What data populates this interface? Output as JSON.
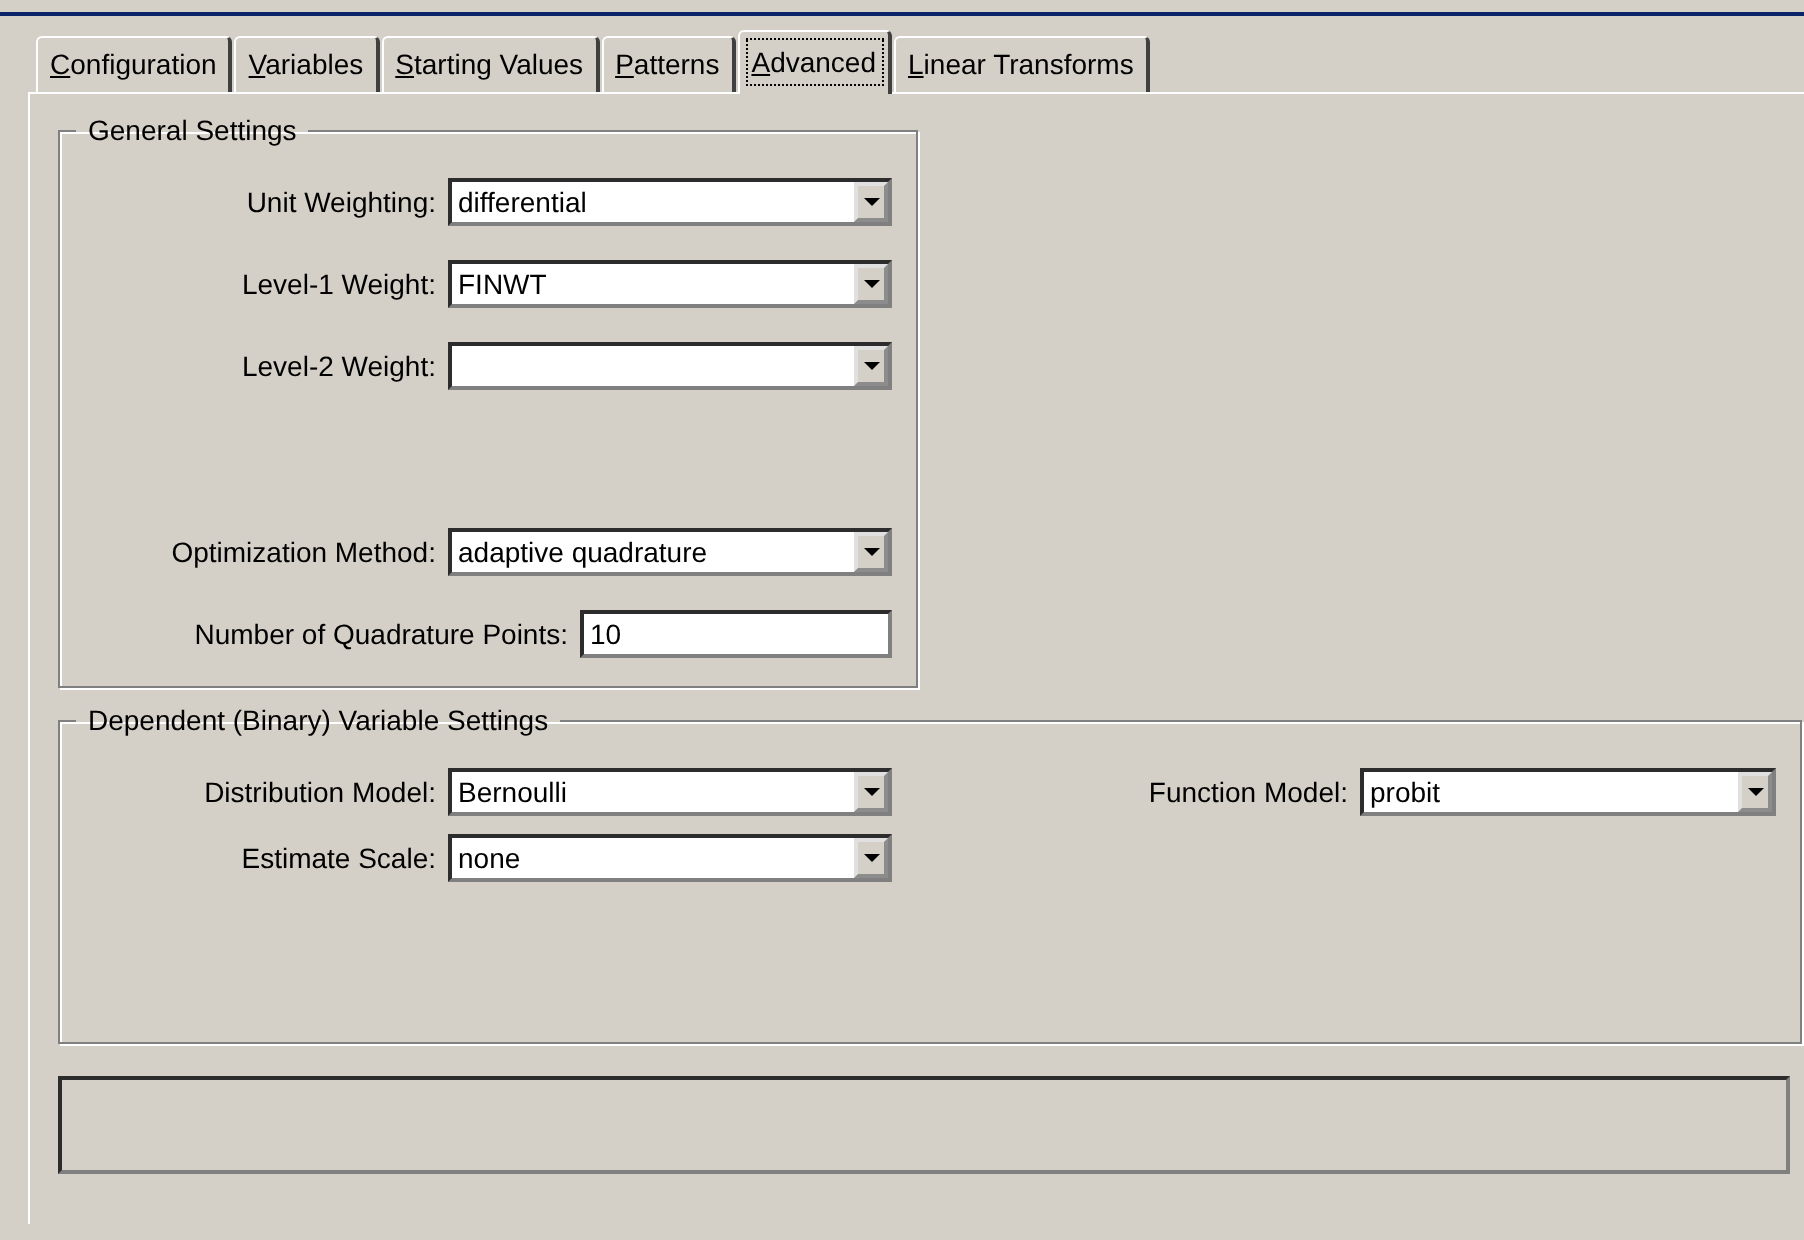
{
  "tabs": [
    {
      "label": "Configuration",
      "selected": false
    },
    {
      "label": "Variables",
      "selected": false
    },
    {
      "label": "Starting Values",
      "selected": false
    },
    {
      "label": "Patterns",
      "selected": false
    },
    {
      "label": "Advanced",
      "selected": true
    },
    {
      "label": "Linear Transforms",
      "selected": false
    }
  ],
  "general_settings": {
    "title": "General Settings",
    "weight_fields": [
      {
        "label": "Unit Weighting:",
        "kind": "dropdown",
        "value": "differential"
      },
      {
        "label": "Level-1 Weight:",
        "kind": "dropdown",
        "value": "FINWT"
      },
      {
        "label": "Level-2 Weight:",
        "kind": "dropdown"
      }
    ],
    "method_fields": [
      {
        "label": "Optimization Method:",
        "kind": "dropdown",
        "value": "adaptive quadrature"
      },
      {
        "label": "Number of Quadrature Points:",
        "kind": "text",
        "value": "10"
      }
    ]
  },
  "dependent_settings": {
    "title": "Dependent (Binary) Variable Settings",
    "left_fields": [
      {
        "label": "Distribution Model:",
        "kind": "dropdown",
        "value": "Bernoulli"
      },
      {
        "label": "Estimate Scale:",
        "kind": "dropdown",
        "value": "none"
      }
    ],
    "right_fields": [
      {
        "label": "Function Model:",
        "kind": "dropdown",
        "value": "probit"
      }
    ]
  }
}
